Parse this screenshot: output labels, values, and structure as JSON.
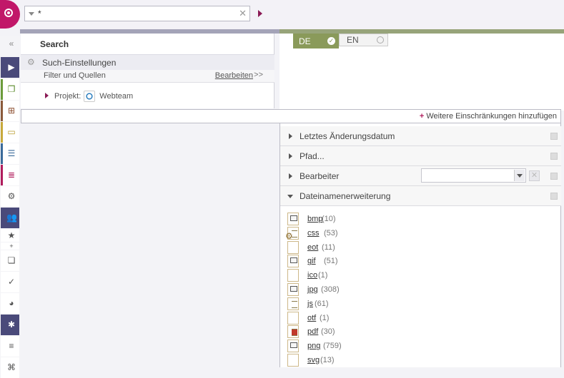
{
  "search": {
    "value": "*"
  },
  "panel": {
    "title": "Search",
    "settings_label": "Such-Einstellungen",
    "filter_label": "Filter und Quellen",
    "edit_label": "Bearbeiten",
    "project_prefix": "Projekt:",
    "project_name": "Webteam"
  },
  "languages": [
    {
      "code": "DE",
      "active": true
    },
    {
      "code": "EN",
      "active": false
    }
  ],
  "overlay": {
    "add_restrictions": "Weitere Einschränkungen hinzufügen",
    "sections": [
      {
        "label": "Letztes Änderungsdatum",
        "expanded": false
      },
      {
        "label": "Pfad...",
        "expanded": false
      },
      {
        "label": "Bearbeiter",
        "expanded": false
      },
      {
        "label": "Dateinamenerweiterung",
        "expanded": true
      }
    ],
    "extensions": [
      {
        "name": "bmp",
        "count": "(10)",
        "icon": "image-file-icon"
      },
      {
        "name": "css",
        "count": "(53)",
        "icon": "css-file-icon"
      },
      {
        "name": "eot",
        "count": "(11)",
        "icon": "blank-file-icon"
      },
      {
        "name": "gif",
        "count": "(51)",
        "icon": "image-file-icon"
      },
      {
        "name": "ico",
        "count": "(1)",
        "icon": "blank-file-icon"
      },
      {
        "name": "jpg",
        "count": "(308)",
        "icon": "image-file-icon"
      },
      {
        "name": "js",
        "count": "(61)",
        "icon": "script-file-icon"
      },
      {
        "name": "otf",
        "count": "(1)",
        "icon": "blank-file-icon"
      },
      {
        "name": "pdf",
        "count": "(30)",
        "icon": "pdf-file-icon"
      },
      {
        "name": "png",
        "count": "(759)",
        "icon": "image-file-icon"
      },
      {
        "name": "svg",
        "count": "(13)",
        "icon": "blank-file-icon"
      }
    ]
  },
  "colors": {
    "brand": "#c11769",
    "rail_dark": "#4a4a7a",
    "lang_active": "#8a9a5a"
  }
}
